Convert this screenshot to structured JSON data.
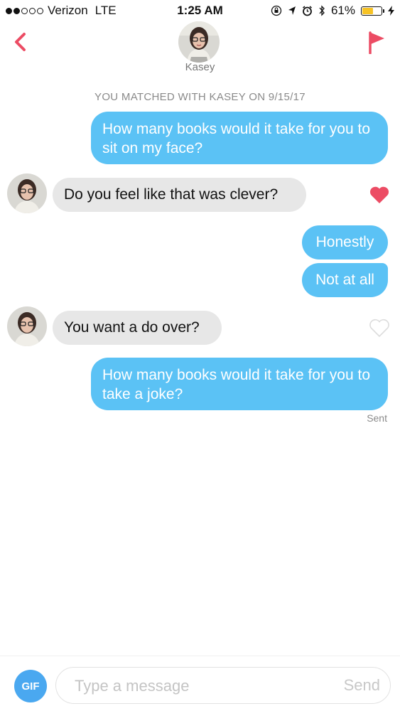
{
  "status_bar": {
    "carrier": "Verizon",
    "network": "LTE",
    "time": "1:25 AM",
    "battery_text": "61%",
    "battery_level": 0.61,
    "signal_bars": 2,
    "icons": [
      "rotation-lock-icon",
      "location-icon",
      "alarm-icon",
      "bluetooth-icon",
      "charging-icon"
    ]
  },
  "header": {
    "back_icon": "chevron-left-icon",
    "name": "Kasey",
    "flag_icon": "flag-icon",
    "accent_color": "#ec4c64"
  },
  "match_banner": "YOU MATCHED WITH KASEY ON 9/15/17",
  "messages": [
    {
      "from": "me",
      "text": "How many books would it take for you to sit on my face?"
    },
    {
      "from": "them",
      "text": "Do you feel like that was clever?",
      "liked": true
    },
    {
      "from": "me",
      "text": "Honestly"
    },
    {
      "from": "me",
      "text": "Not at all"
    },
    {
      "from": "them",
      "text": "You want a do over?",
      "liked": false
    },
    {
      "from": "me",
      "text": "How many books would it take for you to take a joke?"
    }
  ],
  "sent_status": "Sent",
  "composer": {
    "gif_label": "GIF",
    "placeholder": "Type a message",
    "send_label": "Send"
  },
  "colors": {
    "outgoing_bubble": "#5bc2f5",
    "incoming_bubble": "#e7e7e7",
    "gif_button": "#4aa8f0",
    "heart_liked": "#ec4c64"
  }
}
